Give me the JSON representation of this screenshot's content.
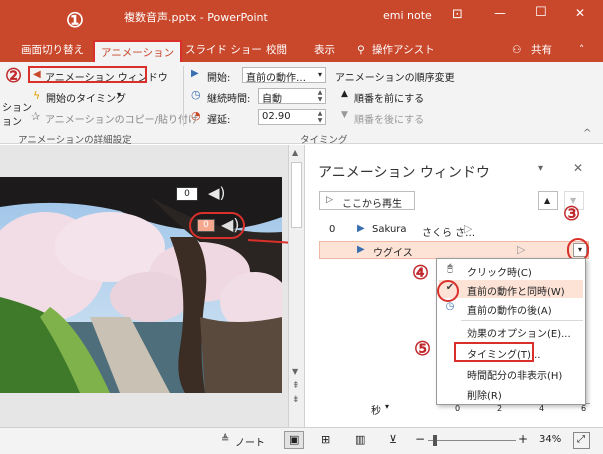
{
  "window": {
    "doc_title": "複数音声.pptx  -  PowerPoint",
    "user": "emi note",
    "minimize": "—",
    "maximize": "☐",
    "close": "✕"
  },
  "tabs": {
    "transitions": "画面切り替え",
    "animations": "アニメーション",
    "slideshow": "スライド ショー",
    "review": "校閲",
    "view": "表示",
    "tellme": "操作アシスト",
    "share": "共有"
  },
  "ribbon": {
    "anim_pane_btn": "アニメーション ウィンドウ",
    "trigger_btn": "開始のタイミング",
    "painter_btn": "アニメーションのコピー/貼り付け",
    "left_cut": "ション",
    "left_cut2": "ョン",
    "group_advanced": "アニメーションの詳細設定",
    "start_label": "開始:",
    "start_value": "直前の動作…",
    "duration_label": "継続時間:",
    "duration_value": "自動",
    "delay_label": "遅延:",
    "delay_value": "02.90",
    "reorder_label": "アニメーションの順序変更",
    "move_earlier": "順番を前にする",
    "move_later": "順番を後にする",
    "group_timing": "タイミング"
  },
  "slide": {
    "badge_top": "0",
    "badge_mid": "0"
  },
  "pane": {
    "title": "アニメーション ウィンドウ",
    "play_from": "ここから再生",
    "items": [
      {
        "num": "0",
        "name": "Sakura",
        "extra": "さくら さ…"
      },
      {
        "num": "",
        "name": "ウグイス",
        "extra": ""
      }
    ],
    "seconds": "秒",
    "timeline": [
      "0",
      "2",
      "4",
      "6"
    ]
  },
  "context_menu": {
    "items": [
      "クリック時(C)",
      "直前の動作と同時(W)",
      "直前の動作の後(A)",
      "効果のオプション(E)...",
      "タイミング(T)...",
      "時間配分の非表示(H)",
      "削除(R)"
    ]
  },
  "annotations": [
    "①",
    "②",
    "③",
    "④",
    "⑤"
  ],
  "status": {
    "notes": "ノート",
    "zoom": "34%"
  },
  "colors": {
    "brand": "#c9472b",
    "highlight": "#d9302b",
    "selected_row": "#fde2d6"
  }
}
